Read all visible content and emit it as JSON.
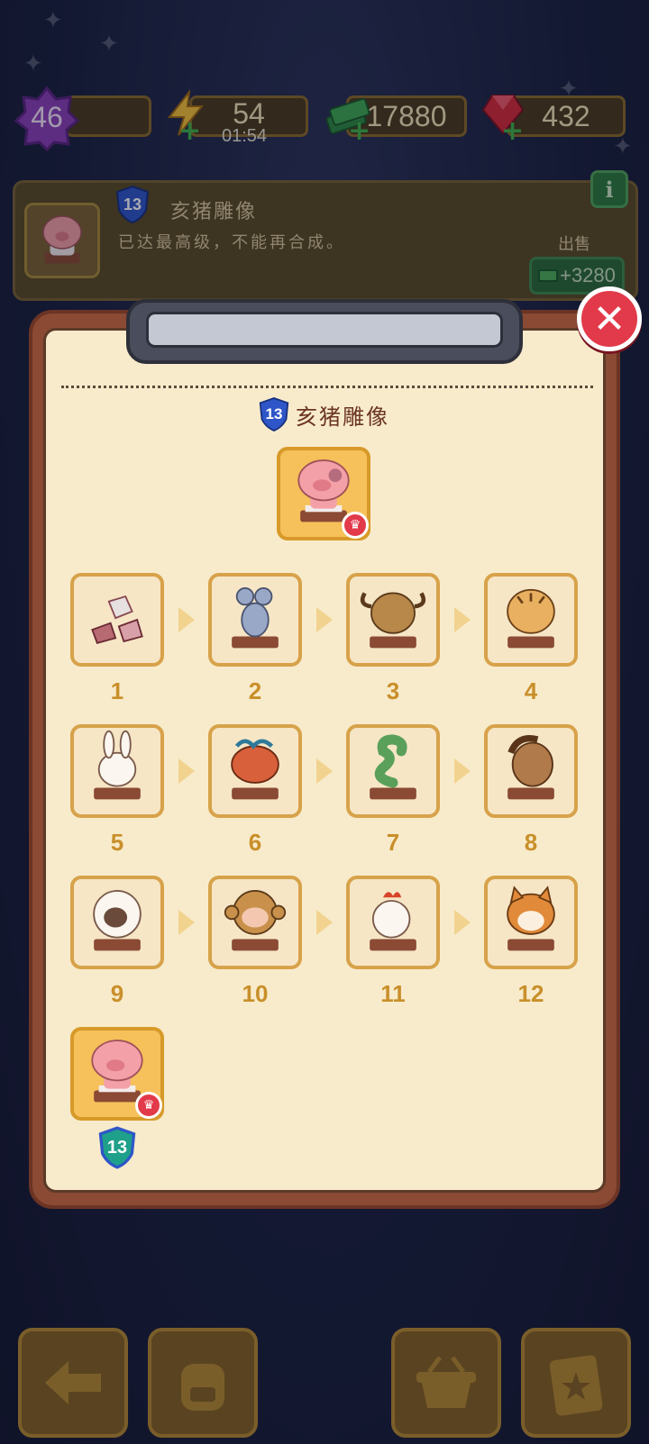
{
  "top_bar": {
    "level": "46",
    "energy": "54",
    "energy_timer": "01:54",
    "cash": "17880",
    "gems": "432"
  },
  "info_panel": {
    "level_badge": "13",
    "item_name": "亥猪雕像",
    "description": "已达最高级，不能再合成。",
    "sell_label": "出售",
    "sell_price": "+3280",
    "info_icon": "info-icon"
  },
  "collection": {
    "level_badge": "13",
    "title": "亥猪雕像",
    "items": [
      {
        "label": "1",
        "icon": "stone-rubble-icon"
      },
      {
        "label": "2",
        "icon": "rat-statue-icon"
      },
      {
        "label": "3",
        "icon": "ox-statue-icon"
      },
      {
        "label": "4",
        "icon": "tiger-statue-icon"
      },
      {
        "label": "5",
        "icon": "rabbit-statue-icon"
      },
      {
        "label": "6",
        "icon": "dragon-statue-icon"
      },
      {
        "label": "7",
        "icon": "snake-statue-icon"
      },
      {
        "label": "8",
        "icon": "horse-statue-icon"
      },
      {
        "label": "9",
        "icon": "sheep-statue-icon"
      },
      {
        "label": "10",
        "icon": "monkey-statue-icon"
      },
      {
        "label": "11",
        "icon": "rooster-statue-icon"
      },
      {
        "label": "12",
        "icon": "dog-statue-icon"
      },
      {
        "label": "",
        "icon": "pig-statue-icon",
        "badge": "13"
      }
    ]
  },
  "bottom_bar": [
    "back-arrow-icon",
    "backpack-icon",
    "basket-icon",
    "star-clipboard-icon"
  ],
  "colors": {
    "paper": "#f8ebcb",
    "board": "#8a4a34",
    "tile_border": "#d7a24a",
    "number": "#c98f2a",
    "close_red": "#e23a4a",
    "badge_blue": "#2f56c8",
    "badge_teal": "#1fa08a"
  }
}
